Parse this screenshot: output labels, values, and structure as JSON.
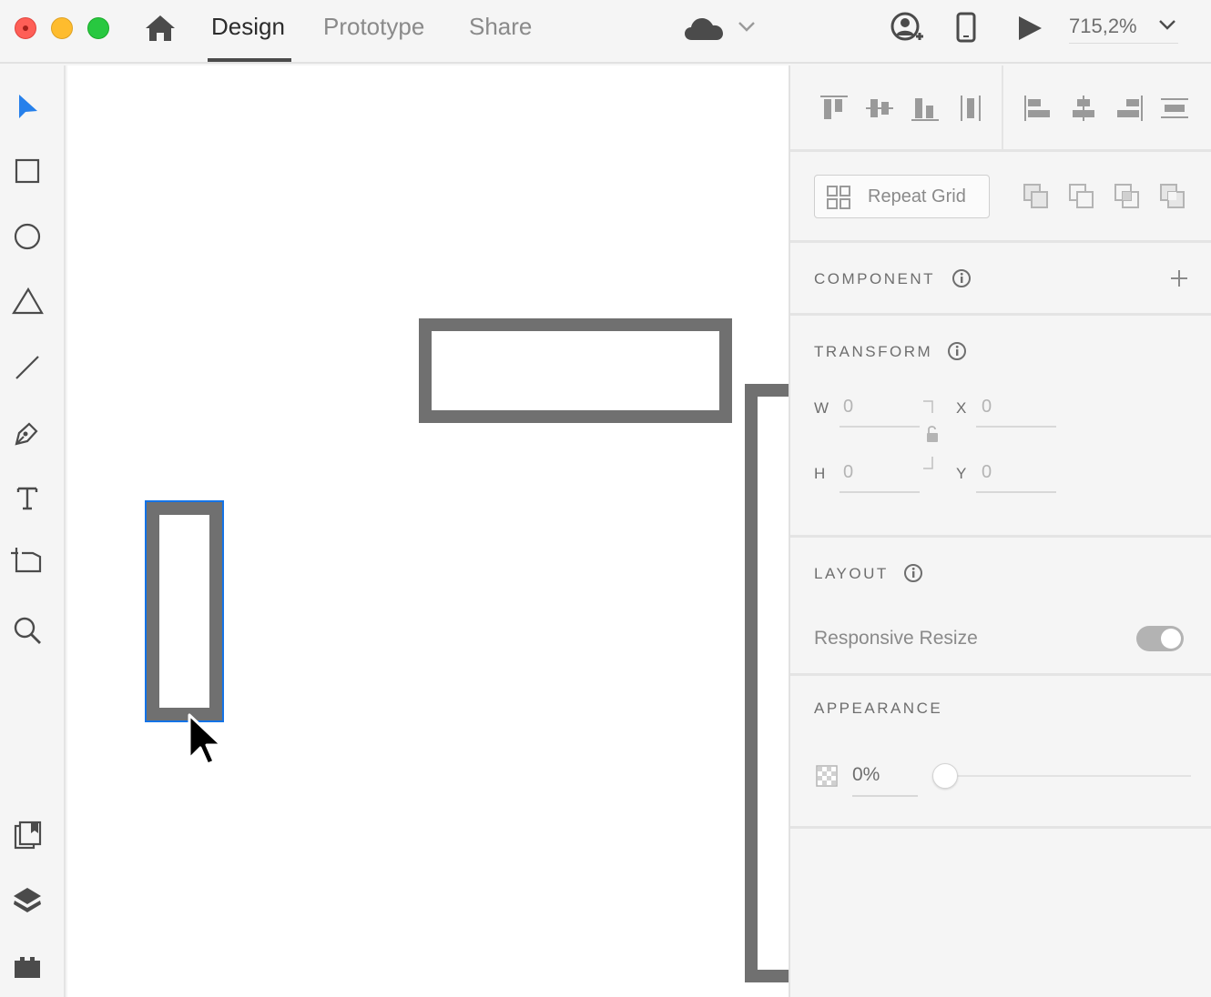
{
  "window": {
    "tabs": [
      {
        "label": "Design",
        "active": true
      },
      {
        "label": "Prototype",
        "active": false
      },
      {
        "label": "Share",
        "active": false
      }
    ],
    "zoom": "715,2%",
    "icons": [
      "home-icon",
      "cloud-icon",
      "chevron-down-icon",
      "share-user-icon",
      "device-preview-icon",
      "play-icon",
      "chevron-down-icon"
    ]
  },
  "toolbar": {
    "tools": [
      "select-tool-icon",
      "rectangle-tool-icon",
      "ellipse-tool-icon",
      "polygon-tool-icon",
      "line-tool-icon",
      "pen-tool-icon",
      "text-tool-icon",
      "artboard-tool-icon",
      "zoom-tool-icon"
    ],
    "bottom": [
      "assets-icon",
      "layers-icon",
      "plugins-icon"
    ]
  },
  "panel": {
    "repeat_grid": "Repeat Grid",
    "component": {
      "title": "COMPONENT"
    },
    "transform": {
      "title": "TRANSFORM",
      "w_label": "W",
      "w_value": "0",
      "h_label": "H",
      "h_value": "0",
      "x_label": "X",
      "x_value": "0",
      "y_label": "Y",
      "y_value": "0"
    },
    "layout": {
      "title": "LAYOUT",
      "responsive_resize": "Responsive Resize",
      "responsive_on": true
    },
    "appearance": {
      "title": "APPEARANCE",
      "opacity": "0%",
      "opacity_fraction": 0.0
    }
  },
  "colors": {
    "accent": "#1473e6",
    "shape_stroke": "#707070",
    "select_tool": "#2680eb"
  }
}
